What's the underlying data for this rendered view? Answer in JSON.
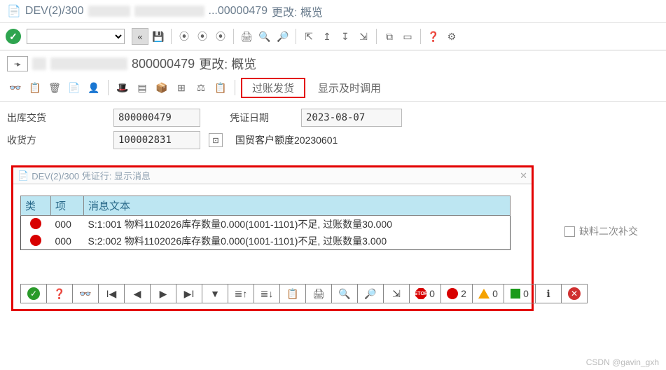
{
  "titlebar": {
    "prefix": "DEV(2)/300",
    "doc_fragment": "...00000479",
    "suffix": "更改: 概览"
  },
  "subtitle": {
    "doc_no": "800000479",
    "suffix": "更改: 概览"
  },
  "toolbar2": {
    "post_goods": "过账发货",
    "show_timing": "显示及时调用"
  },
  "form": {
    "outbound_delivery_label": "出库交货",
    "outbound_delivery_value": "800000479",
    "voucher_date_label": "凭证日期",
    "voucher_date_value": "2023-08-07",
    "receiver_label": "收货方",
    "receiver_value": "100002831",
    "receiver_desc": "国贸客户额度20230601"
  },
  "right": {
    "shortage_label": "缺料二次补交"
  },
  "popup": {
    "title": "DEV(2)/300 凭证行: 显示消息",
    "columns": {
      "type": "类",
      "item": "项",
      "text": "消息文本"
    },
    "rows": [
      {
        "status": "error",
        "item": "000",
        "text": "S:1:001 物料1102026库存数量0.000(1001-1101)不足, 过账数量30.000"
      },
      {
        "status": "error",
        "item": "000",
        "text": "S:2:002 物料1102026库存数量0.000(1001-1101)不足, 过账数量3.000"
      }
    ],
    "counts": {
      "stop": "0",
      "error": "2",
      "warn": "0",
      "ok": "0"
    }
  },
  "watermark": "CSDN @gavin_gxh"
}
